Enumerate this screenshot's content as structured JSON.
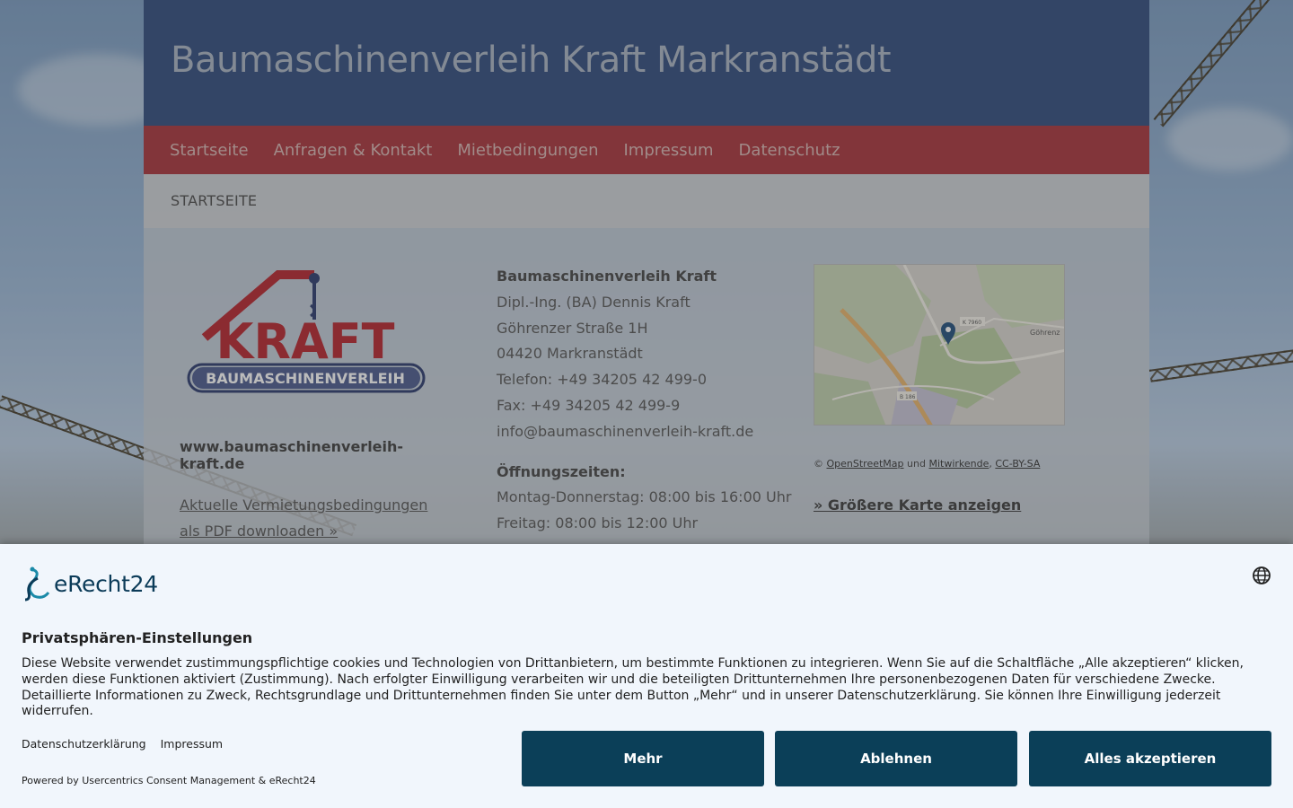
{
  "site": {
    "title": "Baumaschinenverleih Kraft Markranstädt"
  },
  "nav": {
    "items": [
      "Startseite",
      "Anfragen & Kontakt",
      "Mietbedingungen",
      "Impressum",
      "Datenschutz"
    ]
  },
  "breadcrumb": "STARTSEITE",
  "logo": {
    "brand": "KRAFT",
    "sub": "BAUMASCHINENVERLEIH"
  },
  "col1": {
    "url": "www.baumaschinenverleih-kraft.de",
    "pdf_link_line1": "Aktuelle Vermietungsbedingungen",
    "pdf_link_line2": "als PDF downloaden »"
  },
  "address": {
    "company": "Baumaschinenverleih Kraft",
    "person": "Dipl.-Ing. (BA) Dennis Kraft",
    "street": "Göhrenzer Straße 1H",
    "city": "04420 Markranstädt",
    "phone": "Telefon: +49 34205 42 499-0",
    "fax": "Fax: +49 34205 42 499-9",
    "email": "info@baumaschinenverleih-kraft.de"
  },
  "hours": {
    "title": "Öffnungszeiten:",
    "line1": "Montag-Donnerstag: 08:00 bis 16:00 Uhr",
    "line2": "Freitag: 08:00 bis 12:00 Uhr"
  },
  "map": {
    "labels": [
      "Göhrenz",
      "K 7960",
      "B 186"
    ],
    "attribution_prefix": "©",
    "osm": "OpenStreetMap",
    "und": "und",
    "contributors": "Mitwirkende",
    "license": "CC-BY-SA",
    "bigger_map": "» Größere Karte anzeigen"
  },
  "consent": {
    "brand": "eRecht24",
    "title": "Privatsphären-Einstellungen",
    "text": "Diese Website verwendet zustimmungspflichtige cookies und Technologien von Drittanbietern, um bestimmte Funktionen zu integrieren. Wenn Sie auf die Schaltfläche „Alle akzeptieren“ klicken, werden diese Funktionen aktiviert (Zustimmung). Nach erfolgter Einwilligung verarbeiten wir und die beteiligten Drittunternehmen Ihre personenbezogenen Daten für verschiedene Zwecke. Detaillierte Informationen zu Zweck, Rechtsgrundlage und Drittunternehmen finden Sie unter dem Button „Mehr“ und in unserer Datenschutzerklärung. Sie können Ihre Einwilligung jederzeit widerrufen.",
    "link_privacy": "Datenschutzerklärung",
    "link_imprint": "Impressum",
    "powered": "Powered by Usercentrics Consent Management & eRecht24",
    "btn_more": "Mehr",
    "btn_decline": "Ablehnen",
    "btn_accept": "Alles akzeptieren"
  },
  "colors": {
    "header": "#2e4a7d",
    "nav": "#a8323a",
    "consent_button": "#0b3f58",
    "logo_red": "#b5232b",
    "logo_navy": "#2a3a6e"
  }
}
